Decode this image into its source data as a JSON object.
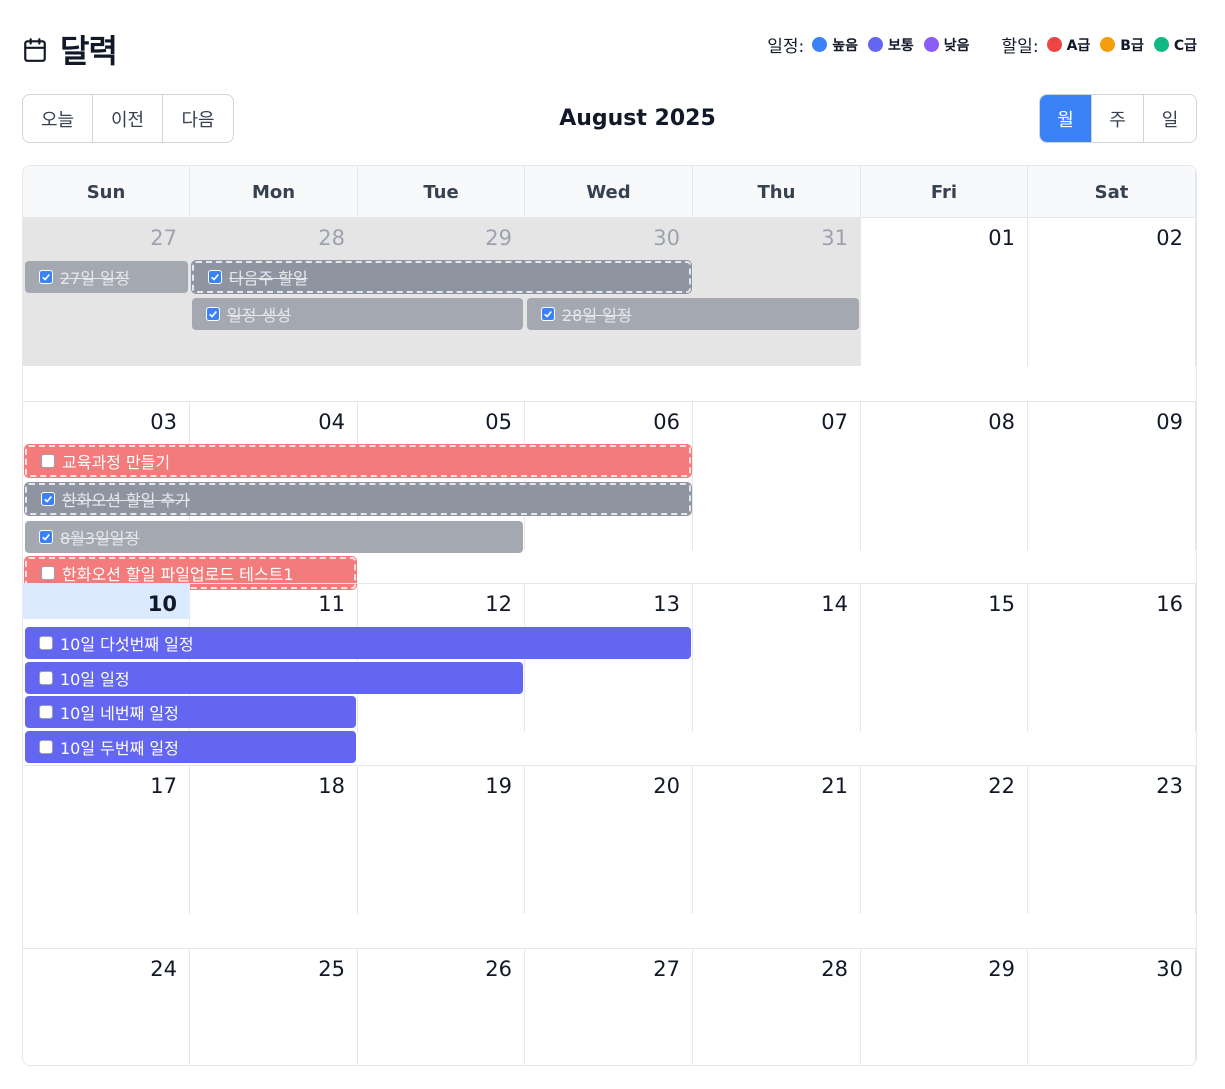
{
  "header": {
    "title": "달력",
    "legend_schedule_label": "일정:",
    "legend_schedule": [
      {
        "label": "높음",
        "color": "#3b82f6"
      },
      {
        "label": "보통",
        "color": "#6366f1"
      },
      {
        "label": "낮음",
        "color": "#8b5cf6"
      }
    ],
    "legend_todo_label": "할일:",
    "legend_todo": [
      {
        "label": "A급",
        "color": "#ef4444"
      },
      {
        "label": "B급",
        "color": "#f59e0b"
      },
      {
        "label": "C급",
        "color": "#10b981"
      }
    ]
  },
  "toolbar": {
    "today": "오늘",
    "prev": "이전",
    "next": "다음",
    "month_title": "August 2025",
    "views": [
      {
        "label": "월",
        "active": true
      },
      {
        "label": "주",
        "active": false
      },
      {
        "label": "일",
        "active": false
      }
    ]
  },
  "calendar": {
    "weekdays": [
      "Sun",
      "Mon",
      "Tue",
      "Wed",
      "Thu",
      "Fri",
      "Sat"
    ],
    "weeks": [
      [
        {
          "d": "27",
          "other": true
        },
        {
          "d": "28",
          "other": true
        },
        {
          "d": "29",
          "other": true
        },
        {
          "d": "30",
          "other": true
        },
        {
          "d": "31",
          "other": true
        },
        {
          "d": "01"
        },
        {
          "d": "02"
        }
      ],
      [
        {
          "d": "03"
        },
        {
          "d": "04"
        },
        {
          "d": "05"
        },
        {
          "d": "06"
        },
        {
          "d": "07"
        },
        {
          "d": "08"
        },
        {
          "d": "09"
        }
      ],
      [
        {
          "d": "10",
          "today": true
        },
        {
          "d": "11"
        },
        {
          "d": "12"
        },
        {
          "d": "13"
        },
        {
          "d": "14"
        },
        {
          "d": "15"
        },
        {
          "d": "16"
        }
      ],
      [
        {
          "d": "17"
        },
        {
          "d": "18"
        },
        {
          "d": "19"
        },
        {
          "d": "20"
        },
        {
          "d": "21"
        },
        {
          "d": "22"
        },
        {
          "d": "23"
        }
      ],
      [
        {
          "d": "24"
        },
        {
          "d": "25"
        },
        {
          "d": "26"
        },
        {
          "d": "27"
        },
        {
          "d": "28"
        },
        {
          "d": "29"
        },
        {
          "d": "30"
        }
      ]
    ],
    "events": [
      {
        "week": 0,
        "start": 0,
        "span": 1,
        "row": 0,
        "title": "27일 일정",
        "style": "done",
        "checked": true
      },
      {
        "week": 0,
        "start": 1,
        "span": 3,
        "row": 0,
        "title": "다음주 할일",
        "style": "todo-done",
        "checked": true
      },
      {
        "week": 0,
        "start": 1,
        "span": 2,
        "row": 1,
        "title": "일정 생성",
        "style": "done",
        "checked": true
      },
      {
        "week": 0,
        "start": 3,
        "span": 2,
        "row": 1,
        "title": "28일 일정",
        "style": "done",
        "checked": true
      },
      {
        "week": 1,
        "start": 0,
        "span": 4,
        "row": 0,
        "title": "교육과정 만들기",
        "style": "todo-a",
        "checked": false
      },
      {
        "week": 1,
        "start": 0,
        "span": 4,
        "row": 1,
        "title": "한화오션 할일 추가",
        "style": "todo-done",
        "checked": true
      },
      {
        "week": 1,
        "start": 0,
        "span": 3,
        "row": 2,
        "title": "8월3일일정",
        "style": "done",
        "checked": true
      },
      {
        "week": 1,
        "start": 0,
        "span": 2,
        "row": 3,
        "title": "한화오션 할일 파일업로드 테스트1",
        "style": "todo-a",
        "checked": false
      },
      {
        "week": 2,
        "start": 0,
        "span": 4,
        "row": 0,
        "title": "10일 다섯번째 일정",
        "style": "normal",
        "checked": false
      },
      {
        "week": 2,
        "start": 0,
        "span": 3,
        "row": 1,
        "title": "10일 일정",
        "style": "normal",
        "checked": false
      },
      {
        "week": 2,
        "start": 0,
        "span": 2,
        "row": 2,
        "title": "10일 네번째 일정",
        "style": "normal",
        "checked": false
      },
      {
        "week": 2,
        "start": 0,
        "span": 2,
        "row": 3,
        "title": "10일 두번째 일정",
        "style": "normal",
        "checked": false
      }
    ]
  }
}
